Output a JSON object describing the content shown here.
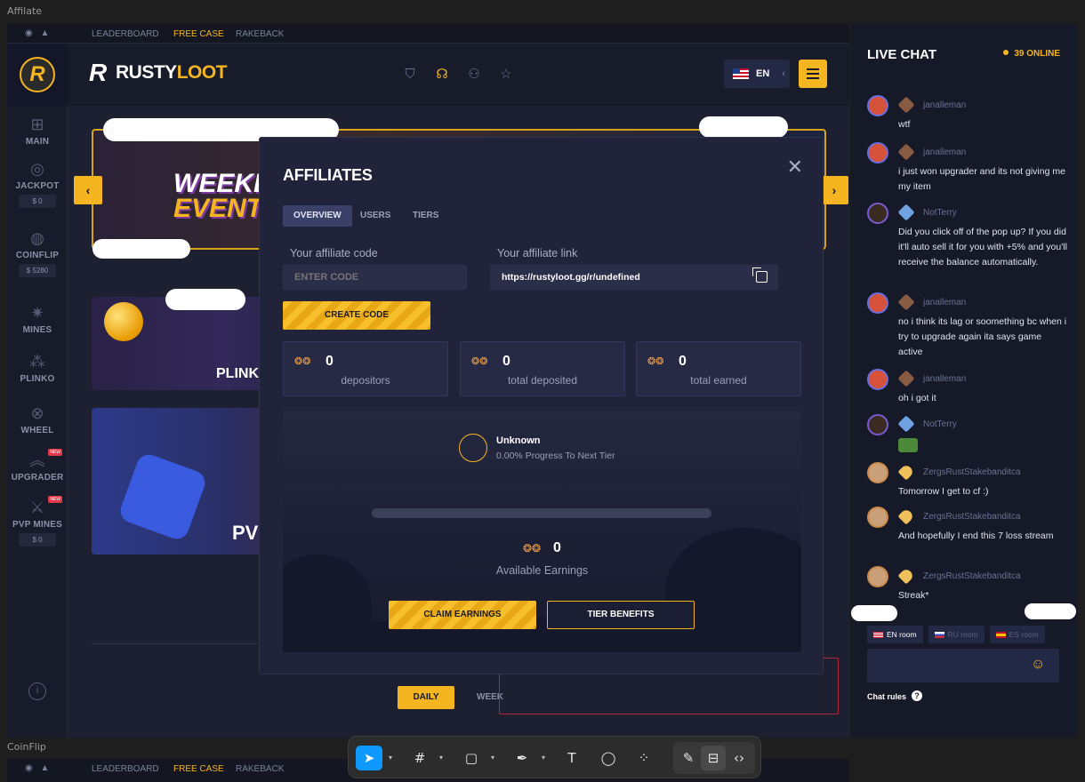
{
  "frames": {
    "top_label": "Affilate",
    "bottom_label": "CoinFlip"
  },
  "topbar": {
    "links": [
      "LEADERBOARD",
      "FREE CASE",
      "RAKEBACK"
    ],
    "active_color": "#f5b521"
  },
  "sidebar": {
    "logo_letter": "R",
    "items": [
      {
        "label": "MAIN",
        "icon": "grid-icon"
      },
      {
        "label": "JACKPOT",
        "icon": "target-icon",
        "amount": "$ 0"
      },
      {
        "label": "COINFLIP",
        "icon": "coin-icon",
        "amount": "$ 5280"
      },
      {
        "label": "MINES",
        "icon": "mine-icon"
      },
      {
        "label": "PLINKO",
        "icon": "plinko-icon"
      },
      {
        "label": "WHEEL",
        "icon": "wheel-icon"
      },
      {
        "label": "UPGRADER",
        "icon": "chevrons-icon",
        "badge": "NEW"
      },
      {
        "label": "PVP MINES",
        "icon": "swords-icon",
        "badge": "NEW",
        "amount": "$ 0"
      }
    ]
  },
  "header": {
    "brand_rusty": "RUSTY",
    "brand_loot": "LOOT",
    "language": "EN",
    "icons": [
      "shield-icon",
      "headset-icon",
      "users-icon",
      "star-icon"
    ]
  },
  "banners": {
    "weekly_line1": "WEEKLY",
    "weekly_line2": "EVENTS",
    "plinko": "PLINKO",
    "pvp": "PVP"
  },
  "leaderboard_tabs": {
    "daily": "DAILY",
    "weekly": "WEEK"
  },
  "modal": {
    "title": "AFFILIATES",
    "tabs": [
      "OVERVIEW",
      "USERS",
      "TIERS"
    ],
    "code_label": "Your affiliate code",
    "code_placeholder": "ENTER CODE",
    "link_label": "Your affiliate link",
    "link_value": "https://rustyloot.gg/r/undefined",
    "create_code": "CREATE CODE",
    "stats": [
      {
        "value": "0",
        "label": "depositors"
      },
      {
        "value": "0",
        "label": "total deposited"
      },
      {
        "value": "0",
        "label": "total earned"
      }
    ],
    "tier_name": "Unknown",
    "tier_progress": "0.00% Progress To Next Tier",
    "tier_progress_fraction": 0.0,
    "available_value": "0",
    "available_label": "Available Earnings",
    "claim": "CLAIM EARNINGS",
    "tier_benefits": "TIER BENEFITS"
  },
  "chat": {
    "title": "LIVE CHAT",
    "online": "39 ONLINE",
    "messages": [
      {
        "user": "janalleman",
        "text": "wtf"
      },
      {
        "user": "janalleman",
        "text": "i just won upgrader and its not giving me my item"
      },
      {
        "user": "NotTerry",
        "text": "Did you click off of the pop up? If you did it'll auto sell it for you with +5% and you'll receive the balance automatically."
      },
      {
        "user": "janalleman",
        "text": "no i think its lag or soomething bc when i try to upgrade again ita says game active"
      },
      {
        "user": "janalleman",
        "text": "oh i got it"
      },
      {
        "user": "NotTerry",
        "text": ""
      },
      {
        "user": "ZergsRustStakebanditca",
        "text": "Tomorrow I get to cf :)"
      },
      {
        "user": "ZergsRustStakebanditca",
        "text": "And hopefully I end this 7 loss stream"
      },
      {
        "user": "ZergsRustStakebanditca",
        "text": "Streak*"
      }
    ],
    "rooms": [
      "EN room",
      "RU room",
      "ES room"
    ],
    "rules": "Chat rules",
    "rules_icon": "?"
  },
  "toolbar": {
    "tools": [
      "move-icon",
      "frame-icon",
      "rectangle-icon",
      "pen-icon",
      "text-icon",
      "comment-icon",
      "actions-icon",
      "draw-icon",
      "dev-mode-icon",
      "code-icon"
    ],
    "selected_color": "#0d99ff"
  }
}
